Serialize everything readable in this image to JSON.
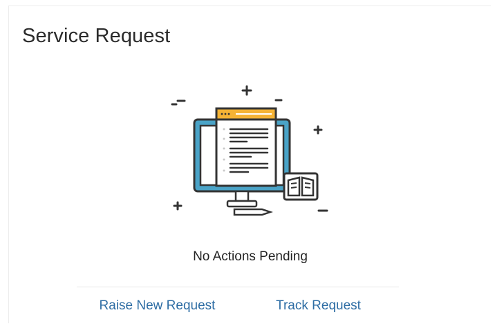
{
  "card": {
    "title": "Service Request"
  },
  "illustration": {
    "icon": "computer-document-book-icon",
    "colors": {
      "outline": "#333333",
      "screen": "#4aa3c7",
      "header": "#f5b335",
      "white": "#ffffff",
      "gray": "#d0d0d0"
    }
  },
  "status": {
    "text": "No Actions Pending"
  },
  "actions": {
    "raise_label": "Raise New Request",
    "track_label": "Track Request"
  },
  "theme": {
    "link_color": "#2e6da4",
    "title_color": "#2b2b2b"
  }
}
